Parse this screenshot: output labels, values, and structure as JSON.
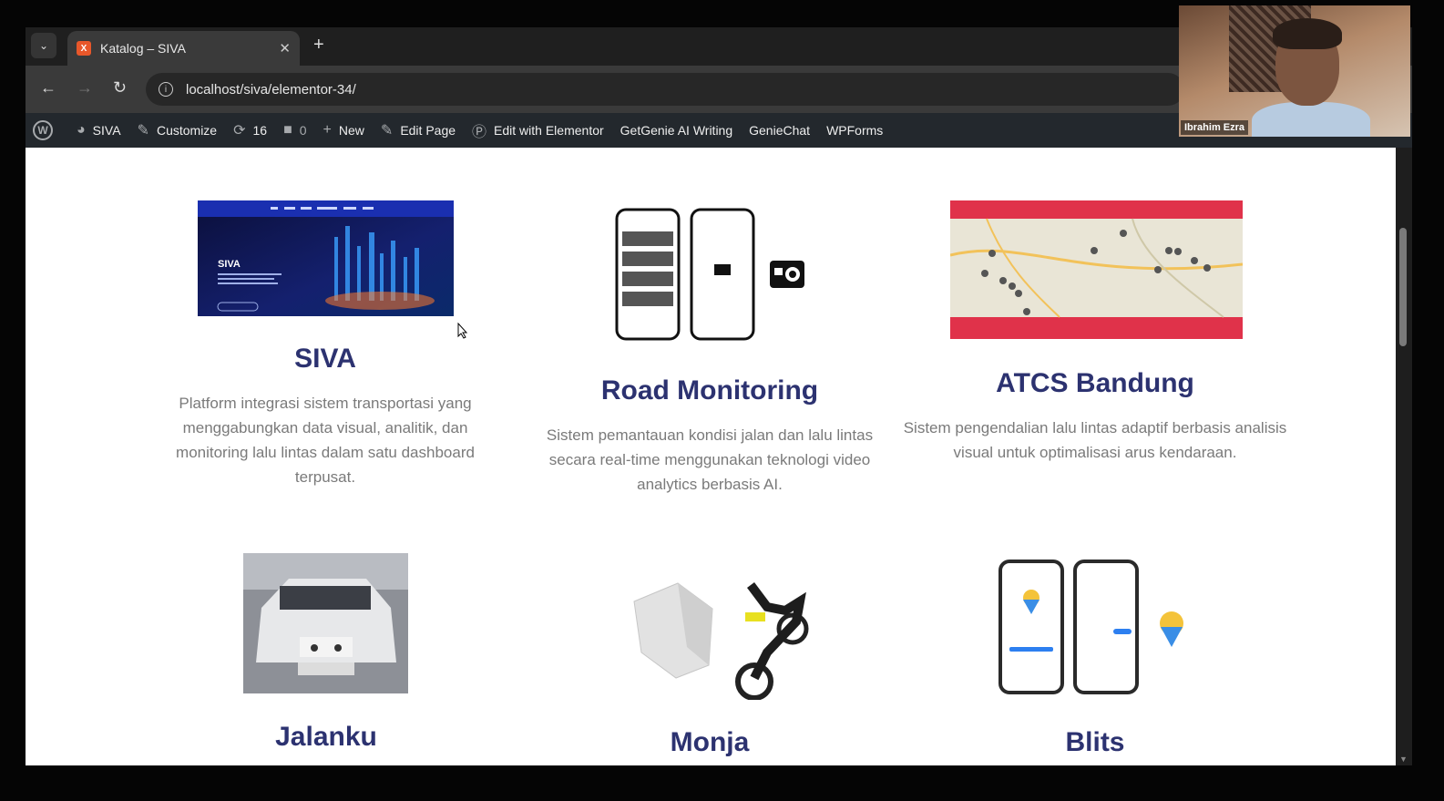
{
  "browser": {
    "tab_title": "Katalog – SIVA",
    "url": "localhost/siva/elementor-34/"
  },
  "adminbar": {
    "site_name": "SIVA",
    "customize": "Customize",
    "updates_count": "16",
    "comments_count": "0",
    "new": "New",
    "edit_page": "Edit Page",
    "edit_elementor": "Edit with Elementor",
    "getgenie": "GetGenie AI Writing",
    "geniechat": "GenieChat",
    "wpforms": "WPForms"
  },
  "products": [
    {
      "title": "SIVA",
      "description": "Platform integrasi sistem transportasi yang menggabungkan data visual, analitik, dan monitoring lalu lintas dalam satu dashboard terpusat.",
      "shot_label": "SIVA"
    },
    {
      "title": "Road Monitoring",
      "description": "Sistem pemantauan kondisi jalan dan lalu lintas secara real-time menggunakan teknologi video analytics berbasis AI."
    },
    {
      "title": "ATCS Bandung",
      "description": "Sistem pengendalian lalu lintas adaptif berbasis analisis visual untuk optimalisasi arus kendaraan."
    },
    {
      "title": "Jalanku",
      "description": ""
    },
    {
      "title": "Monja",
      "description": ""
    },
    {
      "title": "Blits",
      "description": ""
    }
  ],
  "webcam": {
    "participant_name": "Ibrahim Ezra"
  }
}
